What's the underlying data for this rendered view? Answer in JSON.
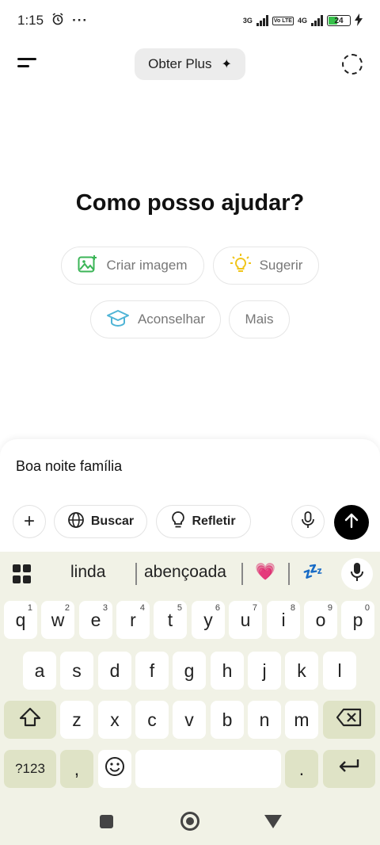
{
  "status_bar": {
    "time": "1:15",
    "dots": "···",
    "net1": "3G",
    "net2": "4G",
    "volte": "Vo LTE",
    "battery": "24",
    "icons": [
      "alarm-icon",
      "signal-icon",
      "battery-icon",
      "charging-icon"
    ]
  },
  "header": {
    "upgrade_label": "Obter Plus",
    "sparkle": "✦"
  },
  "main": {
    "title": "Como posso ajudar?",
    "chips": [
      {
        "label": "Criar imagem",
        "icon": "image-plus-icon",
        "color": "#3bb557"
      },
      {
        "label": "Sugerir",
        "icon": "lightbulb-icon",
        "color": "#f0c419"
      },
      {
        "label": "Aconselhar",
        "icon": "graduation-cap-icon",
        "color": "#4fb4d6"
      },
      {
        "label": "Mais",
        "icon": "",
        "color": ""
      }
    ]
  },
  "composer": {
    "input_value": "Boa noite família",
    "plus": "+",
    "search_label": "Buscar",
    "think_label": "Refletir"
  },
  "keyboard": {
    "suggestions": [
      "linda",
      "abençoada",
      "💗",
      "💤"
    ],
    "row1": [
      {
        "k": "q",
        "n": "1"
      },
      {
        "k": "w",
        "n": "2"
      },
      {
        "k": "e",
        "n": "3"
      },
      {
        "k": "r",
        "n": "4"
      },
      {
        "k": "t",
        "n": "5"
      },
      {
        "k": "y",
        "n": "6"
      },
      {
        "k": "u",
        "n": "7"
      },
      {
        "k": "i",
        "n": "8"
      },
      {
        "k": "o",
        "n": "9"
      },
      {
        "k": "p",
        "n": "0"
      }
    ],
    "row2": [
      "a",
      "s",
      "d",
      "f",
      "g",
      "h",
      "j",
      "k",
      "l"
    ],
    "row3": [
      "z",
      "x",
      "c",
      "v",
      "b",
      "n",
      "m"
    ],
    "symbols_label": "?123",
    "comma": ",",
    "period": ".",
    "emoji": "☺"
  }
}
